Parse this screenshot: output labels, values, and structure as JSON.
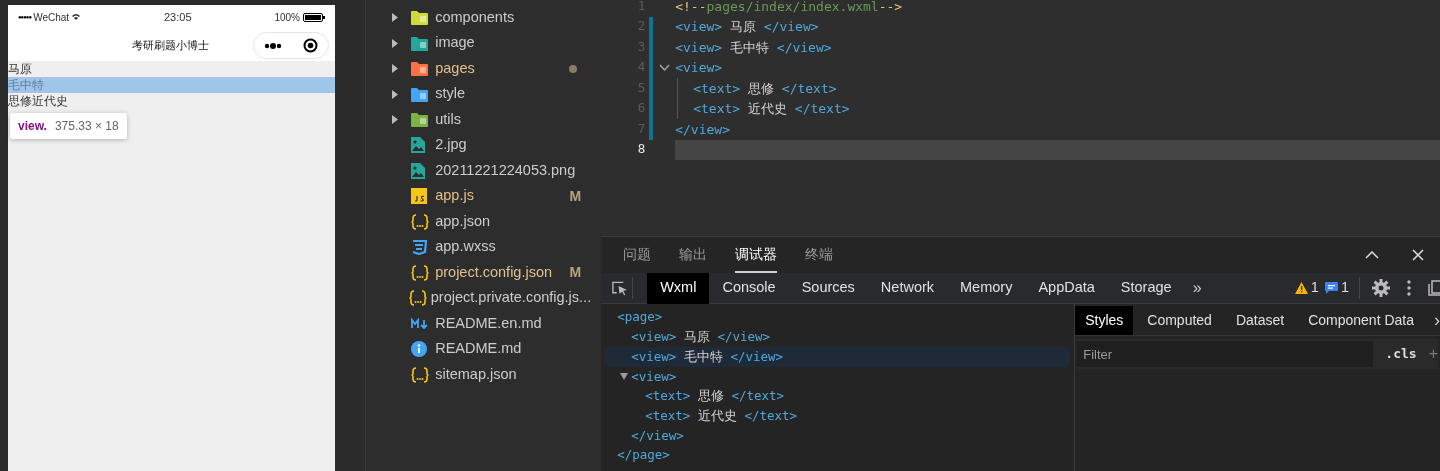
{
  "simulator": {
    "status": {
      "signal": "●●●●●",
      "carrier": "WeChat",
      "time": "23:05",
      "battery": "100%"
    },
    "title": "考研刷题小博士",
    "views": [
      {
        "text": "马原",
        "selected": false
      },
      {
        "text": "毛中特",
        "selected": true
      },
      {
        "text": "思修近代史",
        "selected": false
      }
    ],
    "tooltip": {
      "tag": "view.",
      "size": "375.33 × 18"
    }
  },
  "file_tree": [
    {
      "kind": "folder",
      "color": "#cddc39",
      "name": "components",
      "modified": false
    },
    {
      "kind": "folder",
      "color": "#26a69a",
      "name": "image",
      "modified": false
    },
    {
      "kind": "folder",
      "color": "#ff7043",
      "name": "pages",
      "modified": true,
      "dot": true
    },
    {
      "kind": "folder",
      "color": "#42a5f5",
      "name": "style",
      "modified": false
    },
    {
      "kind": "folder",
      "color": "#7cb342",
      "name": "utils",
      "modified": false
    },
    {
      "kind": "image",
      "name": "2.jpg",
      "modified": false
    },
    {
      "kind": "image",
      "name": "20211221224053.png",
      "modified": false
    },
    {
      "kind": "script",
      "name": "app.js",
      "modified": true,
      "git": "M"
    },
    {
      "kind": "data",
      "name": "app.json",
      "modified": false
    },
    {
      "kind": "stylesheet",
      "name": "app.wxss",
      "modified": false
    },
    {
      "kind": "data",
      "name": "project.config.json",
      "modified": true,
      "git": "M"
    },
    {
      "kind": "data",
      "name": "project.private.config.js...",
      "modified": false
    },
    {
      "kind": "markdown",
      "name": "README.en.md",
      "modified": false
    },
    {
      "kind": "info",
      "name": "README.md",
      "modified": false
    },
    {
      "kind": "data",
      "name": "sitemap.json",
      "modified": false
    }
  ],
  "editor": {
    "lines": [
      {
        "number": "1",
        "changed": false,
        "current": false,
        "tokens": [
          {
            "kind": "punct",
            "text": "<!--"
          },
          {
            "kind": "comment",
            "text": "pages/index/index.wxml"
          },
          {
            "kind": "punct",
            "text": "-->"
          }
        ]
      },
      {
        "number": "2",
        "changed": true,
        "current": false,
        "tokens": [
          {
            "kind": "tag",
            "text": "<view>"
          },
          {
            "kind": "text",
            "text": " 马原 "
          },
          {
            "kind": "tag",
            "text": "</view>"
          }
        ]
      },
      {
        "number": "3",
        "changed": true,
        "current": false,
        "tokens": [
          {
            "kind": "tag",
            "text": "<view>"
          },
          {
            "kind": "text",
            "text": " 毛中特 "
          },
          {
            "kind": "tag",
            "text": "</view>"
          }
        ]
      },
      {
        "number": "4",
        "changed": true,
        "current": false,
        "fold": true,
        "tokens": [
          {
            "kind": "tag",
            "text": "<view>"
          }
        ],
        "children": [
          {
            "number": "5",
            "changed": true,
            "current": false,
            "tokens": [
              {
                "kind": "tag",
                "text": "<text>"
              },
              {
                "kind": "text",
                "text": " 思修 "
              },
              {
                "kind": "tag",
                "text": "</text>"
              }
            ]
          },
          {
            "number": "6",
            "changed": true,
            "current": false,
            "tokens": [
              {
                "kind": "tag",
                "text": "<text>"
              },
              {
                "kind": "text",
                "text": " 近代史 "
              },
              {
                "kind": "tag",
                "text": "</text>"
              }
            ]
          }
        ]
      },
      {
        "number": "7",
        "changed": true,
        "current": false,
        "tokens": [
          {
            "kind": "tag",
            "text": "</view>"
          }
        ]
      },
      {
        "number": "8",
        "changed": false,
        "current": true
      }
    ]
  },
  "panel": {
    "tabs": [
      {
        "label": "问题",
        "selected": false
      },
      {
        "label": "输出",
        "selected": false
      },
      {
        "label": "调试器",
        "selected": true
      },
      {
        "label": "终端",
        "selected": false
      }
    ],
    "devtools_tabs": [
      {
        "label": "Wxml",
        "selected": true
      },
      {
        "label": "Console",
        "selected": false
      },
      {
        "label": "Sources",
        "selected": false
      },
      {
        "label": "Network",
        "selected": false
      },
      {
        "label": "Memory",
        "selected": false
      },
      {
        "label": "AppData",
        "selected": false
      },
      {
        "label": "Storage",
        "selected": false
      }
    ],
    "more": "»",
    "warnings": "1",
    "messages": "1",
    "wxml_tree": [
      {
        "open": "<page>",
        "close": "</page>",
        "children": [
          {
            "open": "<view>",
            "content": "马原",
            "close": "</view>",
            "selected": false
          },
          {
            "open": "<view>",
            "content": "毛中特",
            "close": "</view>",
            "selected": true
          },
          {
            "open": "<view>",
            "close": "</view>",
            "expanded": true,
            "children": [
              {
                "open": "<text>",
                "content": "思修",
                "close": "</text>",
                "selected": false
              },
              {
                "open": "<text>",
                "content": "近代史",
                "close": "</text>",
                "selected": false
              }
            ]
          }
        ]
      }
    ],
    "style_tabs": [
      {
        "label": "Styles",
        "selected": true
      },
      {
        "label": "Computed",
        "selected": false
      },
      {
        "label": "Dataset",
        "selected": false
      },
      {
        "label": "Component Data",
        "selected": false
      }
    ],
    "style_more": "›",
    "filter": {
      "placeholder": "Filter"
    },
    "cls": ".cls",
    "add": "+"
  }
}
